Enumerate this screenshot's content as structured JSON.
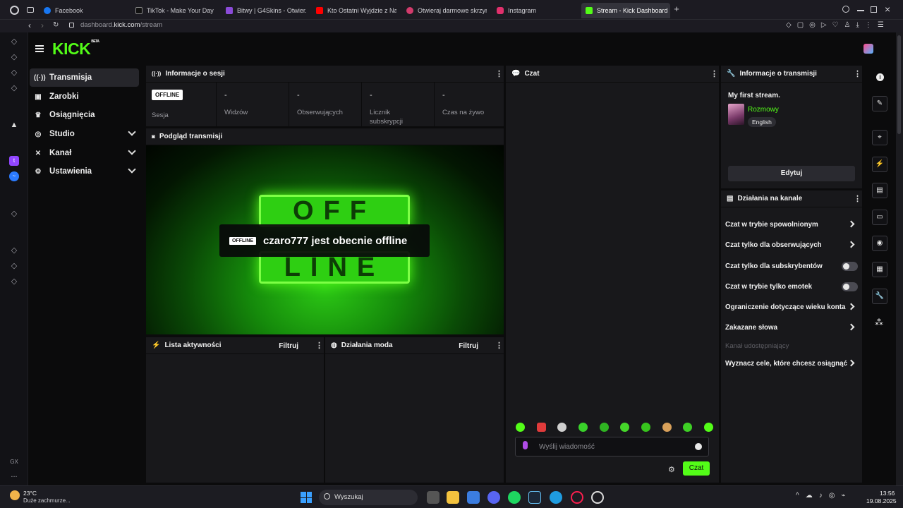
{
  "browser": {
    "tabs": [
      {
        "label": "Facebook",
        "color": "#1877f2",
        "active": false
      },
      {
        "label": "TikTok - Make Your Day",
        "color": "#111111",
        "active": false
      },
      {
        "label": "Bitwy | G4Skins - Otwier...",
        "color": "#8b4bd8",
        "active": false
      },
      {
        "label": "Kto Ostatni Wyjdzie z Naj...",
        "color": "#ff0000",
        "active": false
      },
      {
        "label": "Otwieraj darmowe skrzyn...",
        "color": "#d23b6c",
        "active": false
      },
      {
        "label": "Instagram",
        "color": "#e1306c",
        "active": false
      },
      {
        "label": "Stream - Kick Dashboard",
        "color": "#53fc18",
        "active": true
      }
    ],
    "url_prefix": "dashboard.",
    "url_domain": "kick.com",
    "url_path": "/stream"
  },
  "gx_sidebar": {
    "gx_label": "GX",
    "more": "..."
  },
  "app": {
    "logo": "KICK",
    "logo_badge": "BETA",
    "accent": "#53fc18"
  },
  "nav": [
    {
      "label": "Transmisja",
      "icon": "broadcast-icon",
      "active": true,
      "expandable": false
    },
    {
      "label": "Zarobki",
      "icon": "wallet-icon",
      "active": false,
      "expandable": false
    },
    {
      "label": "Osiągnięcia",
      "icon": "trophy-icon",
      "active": false,
      "expandable": false
    },
    {
      "label": "Studio",
      "icon": "studio-icon",
      "active": false,
      "expandable": true
    },
    {
      "label": "Kanał",
      "icon": "channel-icon",
      "active": false,
      "expandable": true
    },
    {
      "label": "Ustawienia",
      "icon": "gear-icon",
      "active": false,
      "expandable": true
    }
  ],
  "session": {
    "title": "Informacje o sesji",
    "badge": "OFFLINE",
    "badge_label": "Sesja",
    "stats": [
      {
        "value": "-",
        "label": "Widzów"
      },
      {
        "value": "-",
        "label": "Obserwujących"
      },
      {
        "value": "-",
        "label": "Licznik subskrypcji"
      },
      {
        "value": "-",
        "label": "Czas na żywo"
      }
    ]
  },
  "preview": {
    "title": "Podgląd transmisji",
    "badge": "OFFLINE",
    "message": "czaro777 jest obecnie offline",
    "off_letters": "OFF",
    "line_letters": "LINE"
  },
  "activity": {
    "title": "Lista aktywności",
    "filter": "Filtruj"
  },
  "mod": {
    "title": "Działania moda",
    "filter": "Filtruj"
  },
  "chat": {
    "title": "Czat",
    "placeholder": "Wyślij wiadomość",
    "send": "Czat"
  },
  "stream_info": {
    "title": "Informacje o transmisji",
    "stream_title": "My first stream.",
    "category": "Rozmowy",
    "language": "English",
    "edit": "Edytuj"
  },
  "channel_actions": {
    "title": "Działania na kanale",
    "items": [
      {
        "label": "Czat w trybie spowolnionym",
        "type": "arrow"
      },
      {
        "label": "Czat tylko dla obserwujących",
        "type": "arrow"
      },
      {
        "label": "Czat tylko dla subskrybentów",
        "type": "toggle"
      },
      {
        "label": "Czat w trybie tylko emotek",
        "type": "toggle"
      },
      {
        "label": "Ograniczenie dotyczące wieku konta",
        "type": "arrow"
      },
      {
        "label": "Zakazane słowa",
        "type": "arrow"
      },
      {
        "label": "Kanał udostępniający",
        "type": "disabled"
      },
      {
        "label": "Wyznacz cele, które chcesz osiągnąć",
        "type": "arrow"
      }
    ]
  },
  "taskbar": {
    "weather_temp": "23°C",
    "weather_desc": "Duże zachmurze...",
    "search": "Wyszukaj",
    "time": "13:56",
    "date": "19.08.2025"
  }
}
